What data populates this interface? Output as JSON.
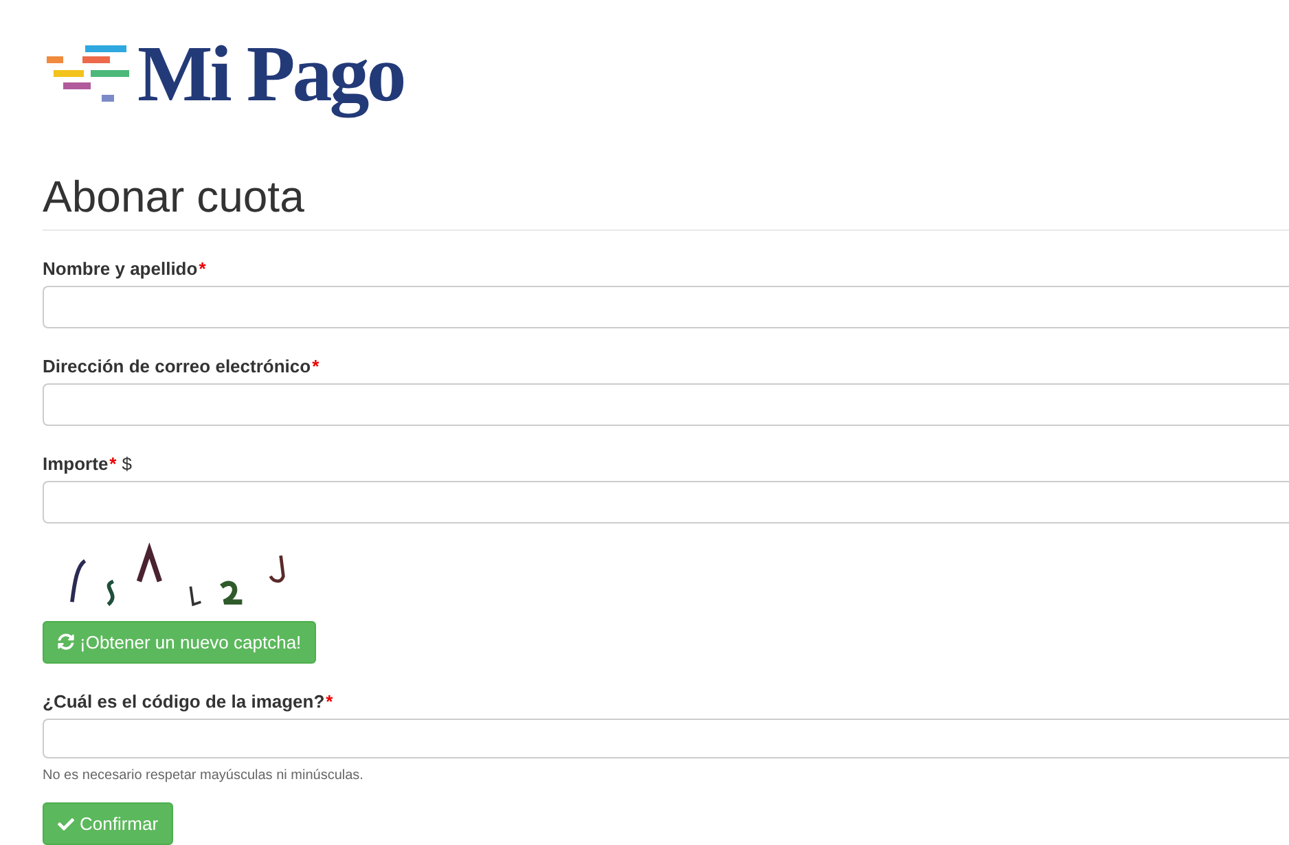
{
  "logo": {
    "text": "Mi Pago"
  },
  "heading": "Abonar cuota",
  "fields": [
    {
      "label": "Nombre y apellido",
      "required": "*",
      "kind": "text"
    },
    {
      "label": "Dirección de correo electrónico",
      "required": "*",
      "kind": "text"
    },
    {
      "label": "Importe",
      "required": "*",
      "suffix": "$",
      "kind": "text"
    }
  ],
  "captcha": {
    "kind": "picture",
    "refresh_button": "¡Obtener un nuevo captcha!"
  },
  "captcha_field": {
    "label": "¿Cuál es el código de la imagen?",
    "required": "*",
    "help": "No es necesario respetar mayúsculas ni minúsculas."
  },
  "submit_button": "Confirmar"
}
